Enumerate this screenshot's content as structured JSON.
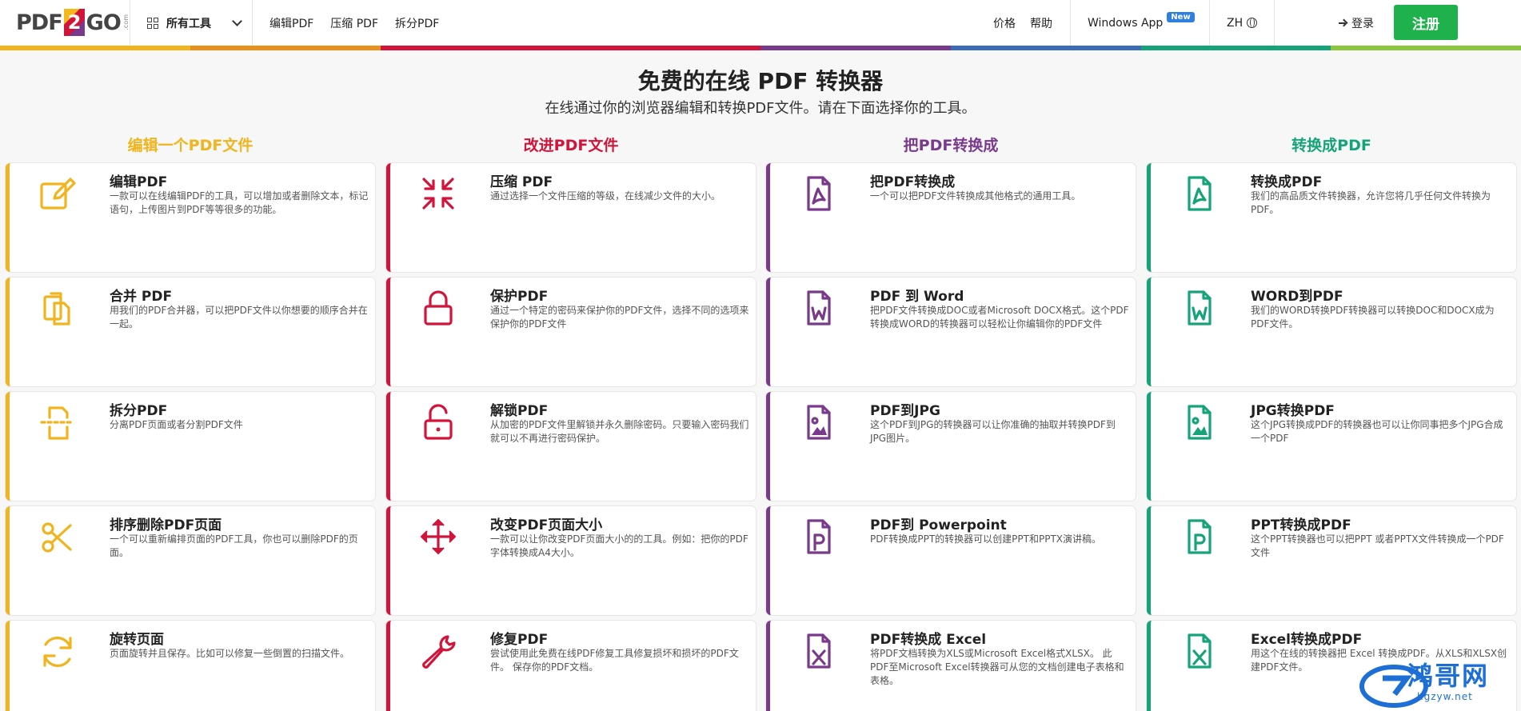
{
  "header": {
    "logo": {
      "left": "PDF",
      "mid": "2",
      "right": "GO",
      "suffix": ".com"
    },
    "all_tools": "所有工具",
    "nav": [
      "编辑PDF",
      "压缩 PDF",
      "拆分PDF"
    ],
    "pricing": "价格",
    "help": "帮助",
    "windows_app": "Windows App",
    "new_badge": "New",
    "language": "ZH",
    "login": "登录",
    "signup": "注册"
  },
  "colors": {
    "yellow": "#f0b51e",
    "red": "#d2143a",
    "purple": "#7a3a8c",
    "green": "#17a37a",
    "rainbow": [
      "#f0b51e",
      "#e8921e",
      "#d2143a",
      "#d2143a",
      "#7a3a8c",
      "#3b6cb5",
      "#17a37a",
      "#8cc63f"
    ]
  },
  "hero": {
    "title": "免费的在线 PDF 转换器",
    "subtitle": "在线通过你的浏览器编辑和转换PDF文件。请在下面选择你的工具。"
  },
  "columns": [
    {
      "title": "编辑一个PDF文件",
      "color": "#f0b51e",
      "cards": [
        {
          "icon": "edit-icon",
          "title": "编辑PDF",
          "desc": "一款可以在线编辑PDF的工具，可以增加或者删除文本，标记语句，上传图片到PDF等等很多的功能。"
        },
        {
          "icon": "merge-icon",
          "title": "合并 PDF",
          "desc": "用我们的PDF合并器，可以把PDF文件以你想要的顺序合并在一起。"
        },
        {
          "icon": "split-icon",
          "title": "拆分PDF",
          "desc": "分离PDF页面或者分割PDF文件"
        },
        {
          "icon": "scissors-icon",
          "title": "排序删除PDF页面",
          "desc": "一个可以重新编排页面的PDF工具，你也可以删除PDF的页面。"
        },
        {
          "icon": "rotate-icon",
          "title": "旋转页面",
          "desc": "页面旋转并且保存。比如可以修复一些倒置的扫描文件。"
        }
      ]
    },
    {
      "title": "改进PDF文件",
      "color": "#d2143a",
      "cards": [
        {
          "icon": "compress-icon",
          "title": "压缩 PDF",
          "desc": "通过选择一个文件压缩的等级，在线减少文件的大小。"
        },
        {
          "icon": "lock-icon",
          "title": "保护PDF",
          "desc": "通过一个特定的密码来保护你的PDF文件，选择不同的选项来保护你的PDF文件"
        },
        {
          "icon": "unlock-icon",
          "title": "解锁PDF",
          "desc": "从加密的PDF文件里解锁并永久删除密码。只要输入密码我们就可以不再进行密码保护。"
        },
        {
          "icon": "resize-icon",
          "title": "改变PDF页面大小",
          "desc": "一款可以让你改变PDF页面大小的的工具。例如：把你的PDF字体转换成A4大小。"
        },
        {
          "icon": "wrench-icon",
          "title": "修复PDF",
          "desc": "尝试使用此免费在线PDF修复工具修复损坏和损坏的PDF文件。 保存你的PDF文档。"
        }
      ]
    },
    {
      "title": "把PDF转换成",
      "color": "#7a3a8c",
      "cards": [
        {
          "icon": "pdf-file-icon",
          "title": "把PDF转换成",
          "desc": "一个可以把PDF文件转换成其他格式的通用工具。"
        },
        {
          "icon": "word-file-icon",
          "title": "PDF 到 Word",
          "desc": "把PDF文件转换成DOC或者Microsoft DOCX格式。这个PDF转换成WORD的转换器可以轻松让你编辑你的PDF文件"
        },
        {
          "icon": "image-file-icon",
          "title": "PDF到JPG",
          "desc": "这个PDF到JPG的转换器可以让你准确的抽取并转换PDF到JPG图片。"
        },
        {
          "icon": "ppt-file-icon",
          "title": "PDF到 Powerpoint",
          "desc": "PDF转换成PPT的转换器可以创建PPT和PPTX演讲稿。"
        },
        {
          "icon": "excel-file-icon",
          "title": "PDF转换成 Excel",
          "desc": "将PDF文档转换为XLS或Microsoft Excel格式XLSX。 此PDF至Microsoft Excel转换器可从您的文档创建电子表格和表格。"
        }
      ]
    },
    {
      "title": "转换成PDF",
      "color": "#17a37a",
      "cards": [
        {
          "icon": "pdf-file-icon",
          "title": "转换成PDF",
          "desc": "我们的高品质文件转换器，允许您将几乎任何文件转换为PDF。"
        },
        {
          "icon": "word-file-icon",
          "title": "WORD到PDF",
          "desc": "我们的WORD转换PDF转换器可以转换DOC和DOCX成为PDF文件。"
        },
        {
          "icon": "image-file-icon",
          "title": "JPG转换PDF",
          "desc": "这个JPG转换成PDF的转换器也可以让你同事把多个JPG合成一个PDF"
        },
        {
          "icon": "ppt-file-icon",
          "title": "PPT转换成PDF",
          "desc": "这个PPT转换器也可以把PPT 或者PPTX文件转换成一个PDF文件"
        },
        {
          "icon": "excel-file-icon",
          "title": "Excel转换成PDF",
          "desc": "用这个在线的转换器把 Excel 转换成PDF。从XLS和XLSX创建PDF文件。"
        }
      ]
    }
  ],
  "watermark": {
    "text": "鸿哥网",
    "sub": "hgzyw.net"
  }
}
